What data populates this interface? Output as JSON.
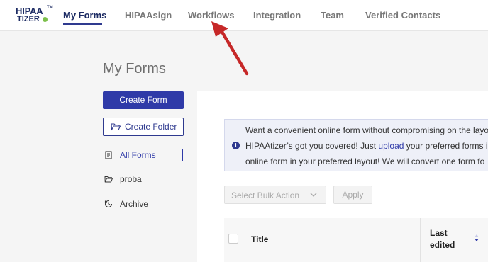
{
  "logo": {
    "line1": "HIPAA",
    "line2": "TIZER",
    "tm": "TM"
  },
  "nav": {
    "items": [
      {
        "label": "My Forms"
      },
      {
        "label": "HIPAAsign"
      },
      {
        "label": "Workflows"
      },
      {
        "label": "Integration"
      },
      {
        "label": "Team"
      },
      {
        "label": "Verified Contacts"
      }
    ]
  },
  "page": {
    "title": "My Forms"
  },
  "sidebar": {
    "create_form_label": "Create Form",
    "create_folder_label": "Create Folder",
    "items": [
      {
        "label": "All Forms",
        "icon": "forms-icon"
      },
      {
        "label": "proba",
        "icon": "folder-icon"
      },
      {
        "label": "Archive",
        "icon": "archive-icon"
      }
    ]
  },
  "info": {
    "line1": "Want a convenient online form without compromising on the layo",
    "line2_before": "HIPAAtizer’s got you covered! Just ",
    "line2_link": "upload",
    "line2_after": " your preferred forms in",
    "line3": "online form in your preferred layout! We will convert one form fo"
  },
  "toolbar": {
    "bulk_placeholder": "Select Bulk Action",
    "apply_label": "Apply"
  },
  "table": {
    "col_title": "Title",
    "col_last_edited": "Last edited"
  },
  "colors": {
    "brand": "#2f3aa8",
    "annotation_arrow": "#c62828",
    "logo_green": "#7cc04b"
  }
}
